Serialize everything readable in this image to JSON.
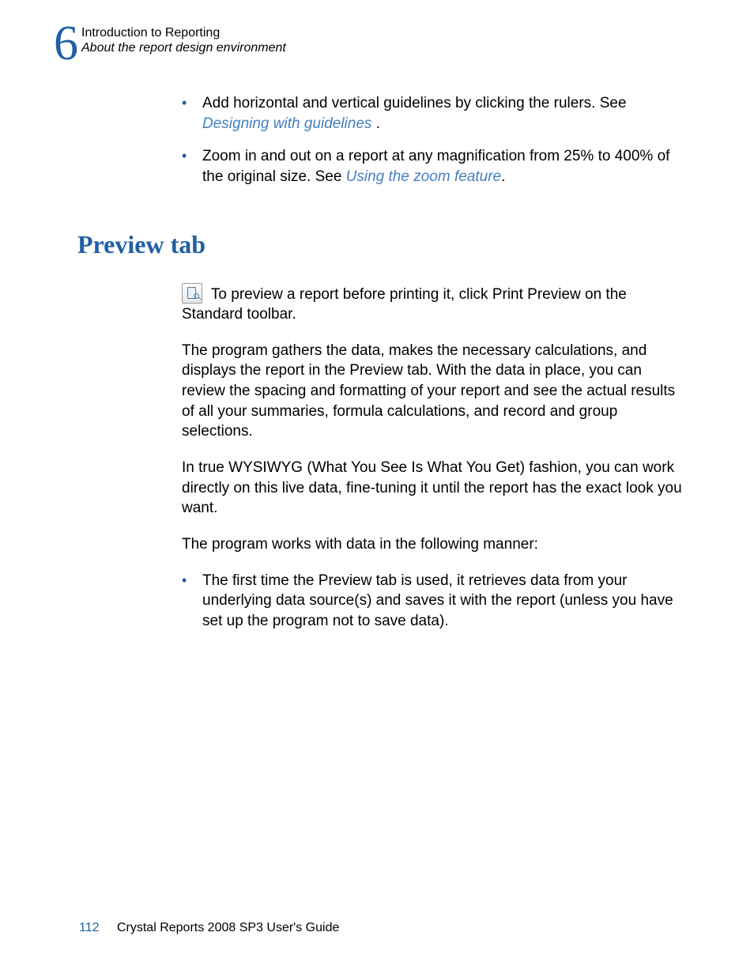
{
  "header": {
    "chapter_number": "6",
    "title": "Introduction to Reporting",
    "subtitle": "About the report design environment"
  },
  "bullets": [
    {
      "pre": "Add horizontal and vertical guidelines by clicking the rulers. See ",
      "link": "Designing with guidelines",
      "post": " ."
    },
    {
      "pre": "Zoom in and out on a report at any magnification from 25% to 400% of the original size. See ",
      "link": "Using the zoom feature",
      "post": "."
    }
  ],
  "section_heading": "Preview tab",
  "paras": {
    "p1": " To preview a report before printing it, click Print Preview on the Standard toolbar.",
    "p2": "The program gathers the data, makes the necessary calculations, and displays the report in the Preview tab. With the data in place, you can review the spacing and formatting of your report and see the actual results of all your summaries, formula calculations, and record and group selections.",
    "p3": "In true WYSIWYG (What You See Is What You Get) fashion, you can work directly on this live data, fine-tuning it until the report has the exact look you want.",
    "p4": "The program works with data in the following manner:"
  },
  "bullets2": [
    {
      "text": "The first time the Preview tab is used, it retrieves data from your underlying data source(s) and saves it with the report (unless you have set up the program not to save data)."
    }
  ],
  "footer": {
    "page": "112",
    "text": "Crystal Reports 2008 SP3 User's Guide"
  }
}
